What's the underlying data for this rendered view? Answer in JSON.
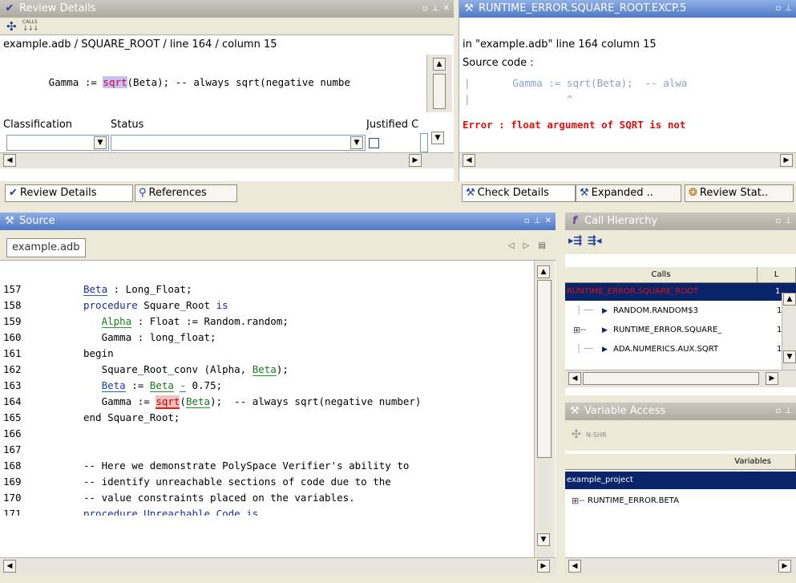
{
  "colors": {
    "error": "#e01010",
    "title_active": "#4f78c6",
    "selection": "#0a246a"
  },
  "review": {
    "title": "Review Details",
    "calls_label": "CALLS",
    "location": "example.adb / SQUARE_ROOT / line 164 / column 15",
    "code_line": "   Gamma := sqrt(Beta); -- always sqrt(negative numbe",
    "code_pre": "   Gamma := ",
    "code_hl": "sqrt",
    "code_post": "(Beta); -- always sqrt(negative numbe",
    "classification_label": "Classification",
    "status_label": "Status",
    "justified_label": "Justified C"
  },
  "runtime": {
    "title": "RUNTIME_ERROR.SQUARE_ROOT.EXCP.5",
    "loc_line": "in \"example.adb\" line 164 column 15",
    "source_label": "Source code :",
    "code_line": "|       Gamma := sqrt(Beta);  -- alwa",
    "caret_line": "|                ^",
    "error_line": "Error : float argument of SQRT is not"
  },
  "tabs_left": {
    "review": "Review Details",
    "references": "References"
  },
  "tabs_right": {
    "check": "Check Details",
    "expanded": "Expanded ..",
    "review_stat": "Review Stat.."
  },
  "source": {
    "title": "Source",
    "file_tab": "example.adb",
    "lines": [
      {
        "n": "157",
        "t": "Beta : Long_Float;"
      },
      {
        "n": "158",
        "t": "procedure Square_Root is"
      },
      {
        "n": "159",
        "t": "   Alpha : Float := Random.random;"
      },
      {
        "n": "160",
        "t": "   Gamma : long_float;"
      },
      {
        "n": "161",
        "t": "begin"
      },
      {
        "n": "162",
        "t": "   Square_Root_conv (Alpha, Beta);"
      },
      {
        "n": "163",
        "t": "   Beta := Beta - 0.75;"
      },
      {
        "n": "164",
        "t": "   Gamma := sqrt(Beta);  -- always sqrt(negative number)"
      },
      {
        "n": "165",
        "t": "end Square_Root;"
      },
      {
        "n": "166",
        "t": ""
      },
      {
        "n": "167",
        "t": ""
      },
      {
        "n": "168",
        "t": "-- Here we demonstrate PolySpace Verifier's ability to"
      },
      {
        "n": "169",
        "t": "-- identify unreachable sections of code due to the"
      },
      {
        "n": "170",
        "t": "-- value constraints placed on the variables."
      },
      {
        "n": "171",
        "t": "procedure Unreachable_Code is"
      }
    ]
  },
  "call_hierarchy": {
    "title": "Call Hierarchy",
    "col_calls": "Calls",
    "col_l": "L",
    "rows": [
      {
        "name": "RUNTIME_ERROR.SQUARE_ROOT",
        "val": "1"
      },
      {
        "name": "RANDOM.RANDOM$3",
        "val": "1"
      },
      {
        "name": "RUNTIME_ERROR.SQUARE_",
        "val": "1"
      },
      {
        "name": "ADA.NUMERICS.AUX.SQRT",
        "val": "1"
      }
    ]
  },
  "variable_access": {
    "title": "Variable Access",
    "nshr_label": "N-SHR",
    "col_variables": "Variables",
    "rows": [
      {
        "name": "example_project"
      },
      {
        "name": "RUNTIME_ERROR.BETA"
      }
    ]
  }
}
